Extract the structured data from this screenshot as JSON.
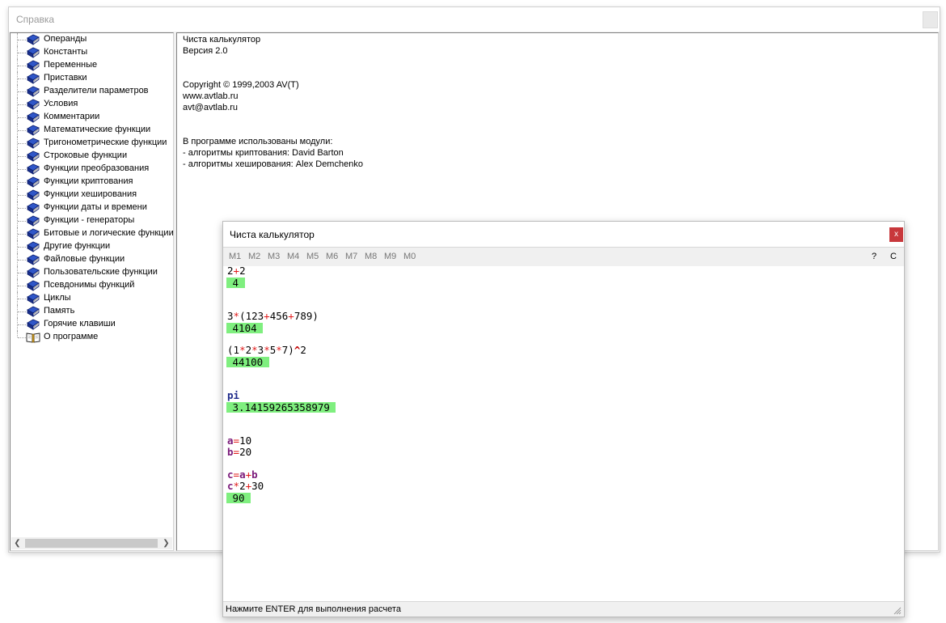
{
  "help_window": {
    "title": "Справка",
    "tree_items": [
      {
        "label": "Операнды",
        "icon": "book-icon"
      },
      {
        "label": "Константы",
        "icon": "book-icon"
      },
      {
        "label": "Переменные",
        "icon": "book-icon"
      },
      {
        "label": "Приставки",
        "icon": "book-icon"
      },
      {
        "label": "Разделители параметров",
        "icon": "book-icon"
      },
      {
        "label": "Условия",
        "icon": "book-icon"
      },
      {
        "label": "Комментарии",
        "icon": "book-icon"
      },
      {
        "label": "Математические функции",
        "icon": "book-icon"
      },
      {
        "label": "Тригонометрические функции",
        "icon": "book-icon"
      },
      {
        "label": "Строковые функции",
        "icon": "book-icon"
      },
      {
        "label": "Функции преобразования",
        "icon": "book-icon"
      },
      {
        "label": "Функции криптования",
        "icon": "book-icon"
      },
      {
        "label": "Функции хеширования",
        "icon": "book-icon"
      },
      {
        "label": "Функции даты и времени",
        "icon": "book-icon"
      },
      {
        "label": "Функции - генераторы",
        "icon": "book-icon"
      },
      {
        "label": "Битовые и логические функции",
        "icon": "book-icon"
      },
      {
        "label": "Другие функции",
        "icon": "book-icon"
      },
      {
        "label": "Файловые функции",
        "icon": "book-icon"
      },
      {
        "label": "Пользовательские функции",
        "icon": "book-icon"
      },
      {
        "label": "Псевдонимы функций",
        "icon": "book-icon"
      },
      {
        "label": "Циклы",
        "icon": "book-icon"
      },
      {
        "label": "Память",
        "icon": "book-icon"
      },
      {
        "label": "Горячие клавиши",
        "icon": "book-icon"
      },
      {
        "label": "О программе",
        "icon": "open-book-icon"
      }
    ],
    "content_lines": [
      "Чиста калькулятор",
      "Версия 2.0",
      "Copyright © 1999,2003 AV(T)",
      "www.avtlab.ru",
      "avt@avtlab.ru",
      "В программе использованы модули:",
      "- алгоритмы криптования: David Barton",
      "- алгоритмы хеширования: Alex Demchenko"
    ]
  },
  "calc_window": {
    "title": "Чиста калькулятор",
    "close_label": "x",
    "memory_buttons": [
      "M1",
      "M2",
      "M3",
      "M4",
      "M5",
      "M6",
      "M7",
      "M8",
      "M9",
      "M0"
    ],
    "help_label": "?",
    "clear_label": "C",
    "expressions": {
      "e1": {
        "a": "2",
        "op": "+",
        "b": "2",
        "result": " 4 "
      },
      "e2": {
        "pre": "3",
        "op1": "*",
        "mid1": "(123",
        "op2": "+",
        "mid2": "456",
        "op3": "+",
        "post": "789)",
        "result": " 4104 "
      },
      "e3": {
        "pre": "(1",
        "op1": "*",
        "n2": "2",
        "op2": "*",
        "n3": "3",
        "op3": "*",
        "n4": "5",
        "op4": "*",
        "n5": "7)",
        "pow": "^",
        "exp": "2",
        "result": " 44100 "
      },
      "e4": {
        "kw": "pi",
        "result": " 3.14159265358979 "
      },
      "e5": {
        "var": "a",
        "eq": "=",
        "val": "10"
      },
      "e6": {
        "var": "b",
        "eq": "=",
        "val": "20"
      },
      "e7": {
        "var_c": "c",
        "eq": "=",
        "var_a": "a",
        "op": "+",
        "var_b": "b"
      },
      "e8": {
        "var": "c",
        "op1": "*",
        "n1": "2",
        "op2": "+",
        "n2": "30",
        "result": " 90 "
      }
    },
    "status_text": "Нажмите ENTER для выполнения расчета"
  }
}
